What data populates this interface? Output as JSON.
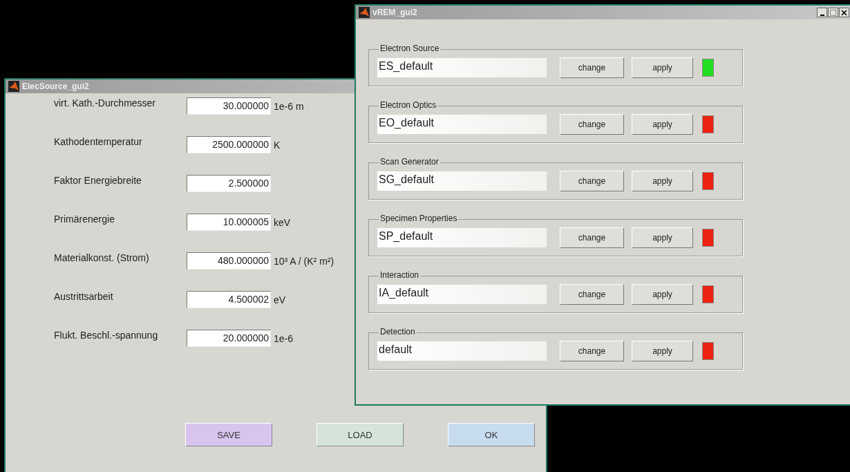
{
  "elec_window": {
    "title": "ElecSource_gui2",
    "parameters": [
      {
        "label": "virt. Kath.-Durchmesser",
        "value": "30.000000",
        "unit": "1e-6 m"
      },
      {
        "label": "Kathodentemperatur",
        "value": "2500.000000",
        "unit": "K"
      },
      {
        "label": "Faktor Energiebreite",
        "value": "2.500000"
      },
      {
        "label": "Primärenergie",
        "value": "10.000005",
        "unit": "keV"
      },
      {
        "label": "Materialkonst. (Strom)",
        "value": "480.000000",
        "unit": "10³ A / (K² m²)"
      },
      {
        "label": "Austrittsarbeit",
        "value": "4.500002",
        "unit": "eV"
      },
      {
        "label": "Flukt. Beschl.-spannung",
        "value": "20.000000",
        "unit": "1e-6"
      }
    ],
    "buttons": [
      {
        "label": "SAVE",
        "color": "#d9c4f0"
      },
      {
        "label": "LOAD",
        "color": "#d4e4da"
      },
      {
        "label": "OK",
        "color": "#c8dcf0"
      }
    ]
  },
  "vrem_window": {
    "title": "vREM_gui2",
    "modules": [
      {
        "title": "Electron Source",
        "value": "ES_default",
        "change": "change",
        "apply": "apply",
        "color": "#22dd22"
      },
      {
        "title": "Electron Optics",
        "value": "EO_default",
        "change": "change",
        "apply": "apply",
        "color": "#ee2211"
      },
      {
        "title": "Scan Generator",
        "value": "SG_default",
        "change": "change",
        "apply": "apply",
        "color": "#ee2211"
      },
      {
        "title": "Specimen Properties",
        "value": "SP_default",
        "change": "change",
        "apply": "apply",
        "color": "#ee2211"
      },
      {
        "title": "Interaction",
        "value": "IA_default",
        "change": "change",
        "apply": "apply",
        "color": "#ee2211"
      },
      {
        "title": "Detection",
        "value": "default",
        "change": "change",
        "apply": "apply",
        "color": "#ee2211"
      }
    ]
  }
}
